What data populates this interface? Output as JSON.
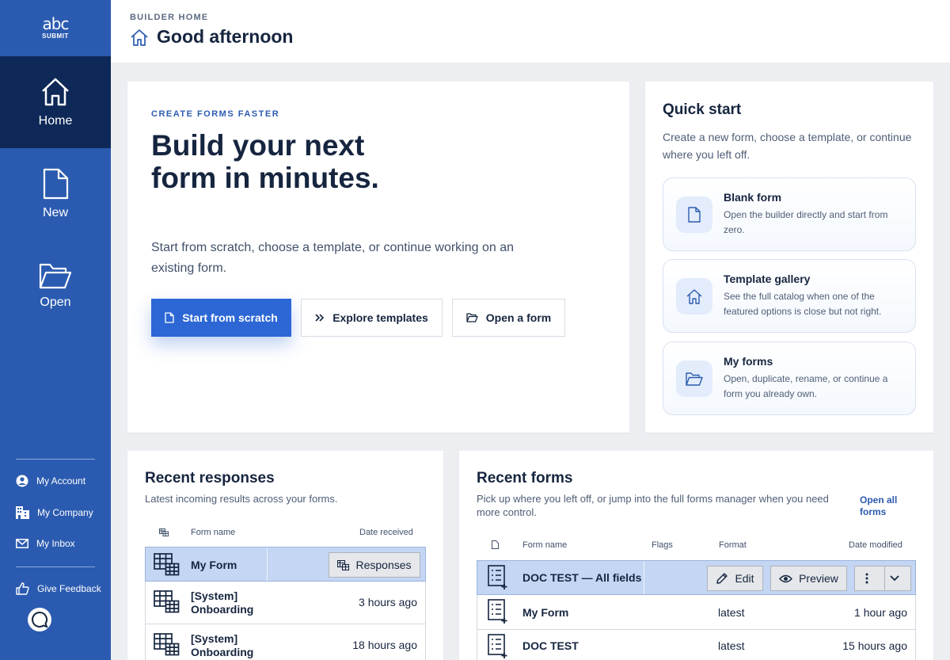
{
  "brand": {
    "logo_text": "abc",
    "logo_sub": "SUBMIT"
  },
  "nav": {
    "home": "Home",
    "new": "New",
    "open": "Open"
  },
  "side": {
    "account": "My Account",
    "company": "My Company",
    "inbox": "My Inbox",
    "feedback": "Give Feedback"
  },
  "header": {
    "breadcrumb": "BUILDER HOME",
    "title": "Good afternoon"
  },
  "hero": {
    "eyebrow": "CREATE FORMS FASTER",
    "headline": "Build your next form in minutes.",
    "lead": "Start from scratch, choose a template, or continue working on an existing form.",
    "btn_scratch": "Start from scratch",
    "btn_templates": "Explore templates",
    "btn_open": "Open a form"
  },
  "quick": {
    "title": "Quick start",
    "desc": "Create a new form, choose a template, or continue where you left off.",
    "items": [
      {
        "name": "Blank form",
        "desc": "Open the builder directly and start from zero.",
        "icon": "file-icon"
      },
      {
        "name": "Template gallery",
        "desc": "See the full catalog when one of the featured options is close but not right.",
        "icon": "home-icon"
      },
      {
        "name": "My forms",
        "desc": "Open, duplicate, rename, or continue a form you already own.",
        "icon": "folder-open-icon"
      }
    ]
  },
  "responses": {
    "title": "Recent responses",
    "desc": "Latest incoming results across your forms.",
    "col_name": "Form name",
    "col_date": "Date received",
    "action_label": "Responses",
    "rows": [
      {
        "name": "My Form",
        "date": ""
      },
      {
        "name": "[System] Onboarding",
        "date": "3 hours ago"
      },
      {
        "name": "[System] Onboarding",
        "date": "18 hours ago"
      }
    ]
  },
  "forms": {
    "title": "Recent forms",
    "desc": "Pick up where you left off, or jump into the full forms manager when you need more control.",
    "open_all": "Open all forms",
    "col_name": "Form name",
    "col_flags": "Flags",
    "col_format": "Format",
    "col_date": "Date modified",
    "edit_label": "Edit",
    "preview_label": "Preview",
    "rows": [
      {
        "name": "DOC TEST — All fields",
        "format": "",
        "date": ""
      },
      {
        "name": "My Form",
        "format": "latest",
        "date": "1 hour ago"
      },
      {
        "name": "DOC TEST",
        "format": "latest",
        "date": "15 hours ago"
      }
    ]
  },
  "colors": {
    "sidebar": "#2b5bb0",
    "sidebar_active": "#0e2957",
    "primary": "#2c67d5",
    "selected_row": "#c4d6f3"
  }
}
